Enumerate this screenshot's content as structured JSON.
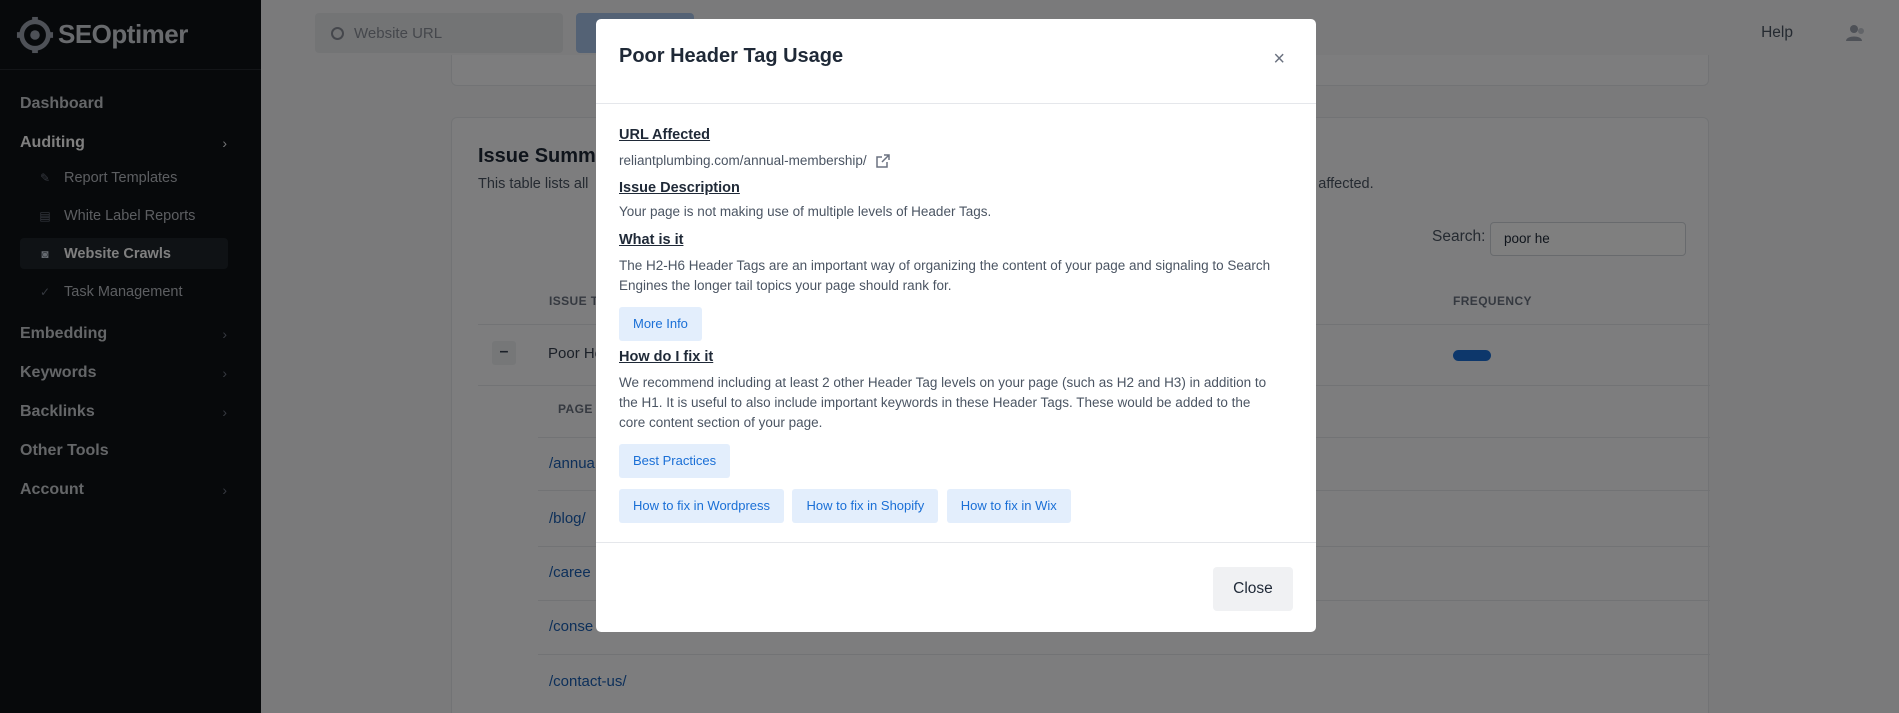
{
  "app": {
    "brand": "SEOptimer"
  },
  "sidebar": {
    "items": [
      {
        "label": "Dashboard"
      },
      {
        "label": "Auditing",
        "chevron": "›"
      },
      {
        "label": "Embedding",
        "chevron": "›"
      },
      {
        "label": "Keywords",
        "chevron": "›"
      },
      {
        "label": "Backlinks",
        "chevron": "›"
      },
      {
        "label": "Other Tools"
      },
      {
        "label": "Account",
        "chevron": "›"
      }
    ],
    "auditing_sub": [
      {
        "label": "Report Templates",
        "icon": "document-edit-icon"
      },
      {
        "label": "White Label Reports",
        "icon": "document-icon"
      },
      {
        "label": "Website Crawls",
        "icon": "crawl-search-icon"
      },
      {
        "label": "Task Management",
        "icon": "check-icon"
      }
    ]
  },
  "topbar": {
    "search_placeholder": "Website URL",
    "help_label": "Help"
  },
  "background": {
    "card_title": "Issue Summa",
    "card_desc": "This table lists all",
    "card_desc_tail": "s affected.",
    "search_label": "Search:",
    "search_value": "poor he",
    "col_issue": "ISSUE T",
    "col_frequency": "FREQUENCY",
    "expand_symbol": "–",
    "row_issue": "Poor He",
    "col_page": "PAGE",
    "pages": [
      "/annua",
      "/blog/",
      "/caree",
      "/conse",
      "/contact-us/"
    ]
  },
  "modal": {
    "title": "Poor Header Tag Usage",
    "close_x": "×",
    "url_affected_title": "URL Affected",
    "url_affected": "reliantplumbing.com/annual-membership/",
    "issue_description_title": "Issue Description",
    "issue_description": "Your page is not making use of multiple levels of Header Tags.",
    "what_is_it_title": "What is it",
    "what_is_it_line1": "The H2-H6 Header Tags are an important way of organizing the content of your page and signaling to Search",
    "what_is_it_line2": "Engines the longer tail topics your page should rank for.",
    "more_info_label": "More Info",
    "how_fix_title": "How do I fix it",
    "how_fix_line1": "We recommend including at least 2 other Header Tag levels on your page (such as H2 and H3) in addition to",
    "how_fix_line2": "the H1. It is useful to also include important keywords in these Header Tags. These would be added to the",
    "how_fix_line3": "core content section of your page.",
    "best_practices_label": "Best Practices",
    "fix_wordpress_label": "How to fix in Wordpress",
    "fix_shopify_label": "How to fix in Shopify",
    "fix_wix_label": "How to fix in Wix",
    "close_label": "Close"
  },
  "colors": {
    "accent": "#1a6fd6",
    "sidebar_bg": "#0f1216",
    "chip_bg": "#e3eefc"
  }
}
